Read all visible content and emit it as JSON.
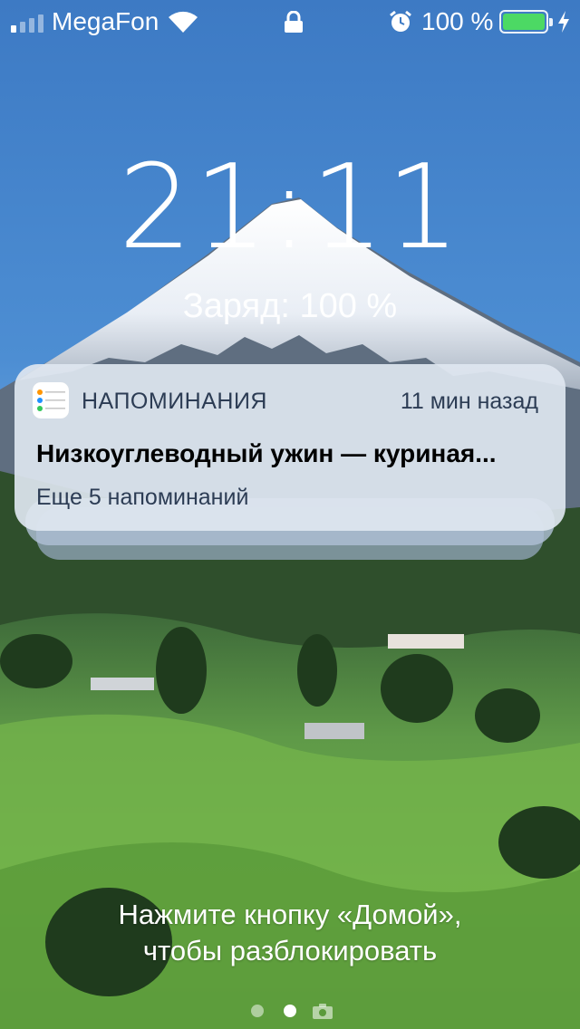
{
  "status_bar": {
    "carrier": "MegaFon",
    "signal_bars": 4,
    "signal_bars_active": 1,
    "battery_percent_label": "100 %",
    "battery_level": 1.0,
    "battery_color": "#4cd964",
    "icons": [
      "signal-icon",
      "wifi-icon",
      "lock-icon",
      "alarm-icon",
      "battery-icon",
      "charging-bolt-icon"
    ]
  },
  "lock_screen": {
    "time_hours": "21",
    "time_colon": ":",
    "time_minutes": "11",
    "charge_text": "Заряд: 100 %"
  },
  "notification": {
    "app_name": "НАПОМИНАНИЯ",
    "app_icon": "reminders-app-icon",
    "time_ago": "11 мин назад",
    "title": "Низкоуглеводный ужин — куриная...",
    "more_label": "Еще 5 напоминаний"
  },
  "unlock_hint": {
    "line1": "Нажмите кнопку «Домой»,",
    "line2": "чтобы разблокировать"
  },
  "pager": {
    "pages": 2,
    "active_page": 2,
    "trailing_icon": "camera-icon"
  }
}
